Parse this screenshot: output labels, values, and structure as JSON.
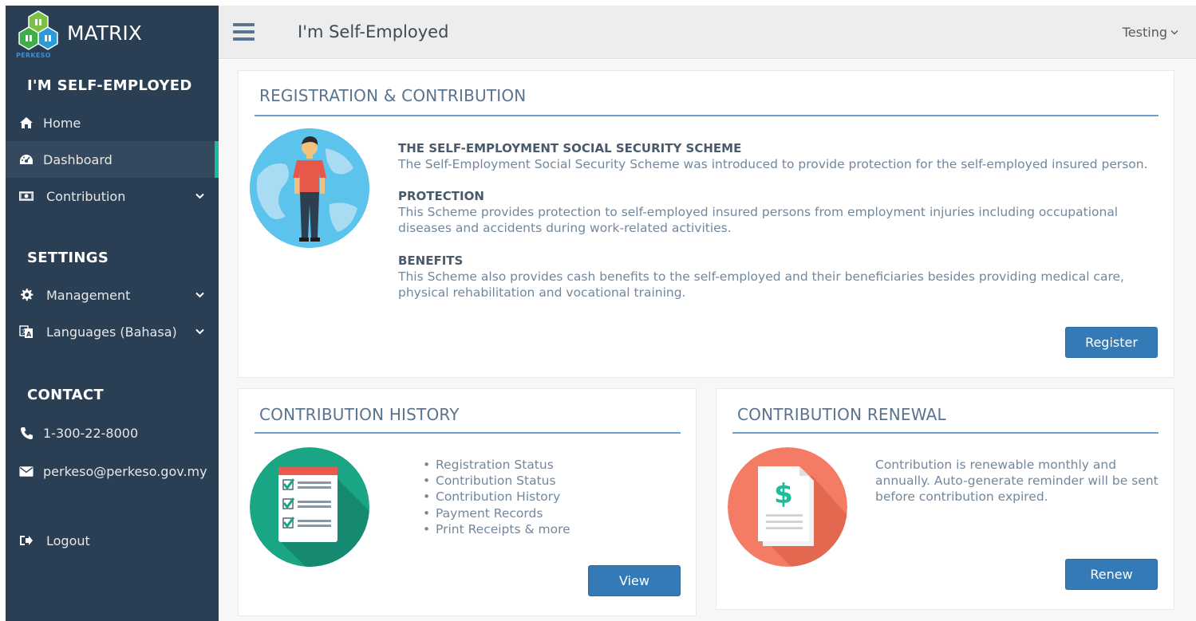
{
  "app": {
    "brand_title": "MATRIX",
    "brand_sub": "PERKESO"
  },
  "sidebar": {
    "section_main": "I'M SELF-EMPLOYED",
    "main_items": [
      {
        "label": "Home",
        "icon": "home-icon"
      },
      {
        "label": "Dashboard",
        "icon": "dashboard-icon",
        "active": true
      },
      {
        "label": "Contribution",
        "icon": "money-icon",
        "has_submenu": true
      }
    ],
    "section_settings": "SETTINGS",
    "settings_items": [
      {
        "label": "Management",
        "icon": "gear-icon",
        "has_submenu": true
      },
      {
        "label": "Languages (Bahasa)",
        "icon": "language-icon",
        "has_submenu": true
      }
    ],
    "section_contact": "CONTACT",
    "contact_items": [
      {
        "label": "1-300-22-8000",
        "icon": "phone-icon"
      },
      {
        "label": "perkeso@perkeso.gov.my",
        "icon": "envelope-icon"
      }
    ],
    "logout_label": "Logout"
  },
  "topbar": {
    "page_title": "I'm Self-Employed",
    "user_name": "Testing"
  },
  "registration": {
    "title": "REGISTRATION & CONTRIBUTION",
    "sections": [
      {
        "heading": "THE SELF-EMPLOYMENT SOCIAL SECURITY SCHEME",
        "text": "The Self-Employment Social Security Scheme was introduced to provide protection for the self-employed insured person."
      },
      {
        "heading": "PROTECTION",
        "text": "This Scheme provides protection to self-employed insured persons from employment injuries including occupational diseases and accidents during work-related activities."
      },
      {
        "heading": "BENEFITS",
        "text": "This Scheme also provides cash benefits to the self-employed and their beneficiaries besides providing medical care, physical rehabilitation and vocational training."
      }
    ],
    "button_label": "Register"
  },
  "history": {
    "title": "CONTRIBUTION HISTORY",
    "items": [
      "Registration Status",
      "Contribution Status",
      "Contribution History",
      "Payment Records",
      "Print Receipts & more"
    ],
    "button_label": "View"
  },
  "renewal": {
    "title": "CONTRIBUTION RENEWAL",
    "text": "Contribution is renewable monthly and annually. Auto-generate reminder will be sent before contribution expired.",
    "button_label": "Renew"
  },
  "colors": {
    "sidebar_bg": "#2a3f54",
    "active_accent": "#1abb9c",
    "button_primary": "#337ab7",
    "panel_rule": "#6f9fca"
  }
}
